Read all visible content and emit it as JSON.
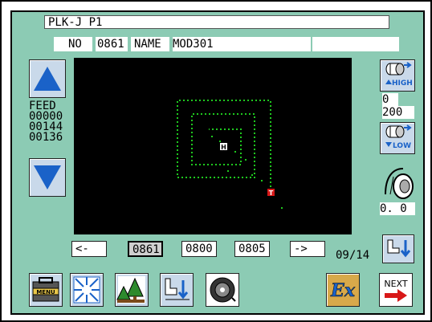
{
  "title": "PLK-J P1",
  "info": {
    "no_label": "NO",
    "no_value": "0861",
    "name_label": "NAME",
    "name_value": "MOD301",
    "extra": ""
  },
  "feed": {
    "label": "FEED",
    "values": [
      "00000",
      "00144",
      "00136"
    ]
  },
  "right_panel": {
    "high_label": "HIGH",
    "low_label": "LOW",
    "speed_top": "0",
    "speed_bottom": "200",
    "tension_value": "0. 0"
  },
  "pattern": {
    "start_marker": "H",
    "end_marker": "T"
  },
  "nav": {
    "prev_label": "<-",
    "pages": [
      "0861",
      "0800",
      "0805"
    ],
    "selected_index": 0,
    "next_label": "->",
    "page_indicator": "09/14"
  },
  "toolbar": {
    "menu_label": "MENU",
    "next_label": "NEXT",
    "ex_label": "Ex"
  },
  "colors": {
    "panel": "#8ccbb4",
    "stitch": "#1ec81e",
    "arrow_blue": "#1a62c8",
    "marker_red": "#d81818"
  }
}
